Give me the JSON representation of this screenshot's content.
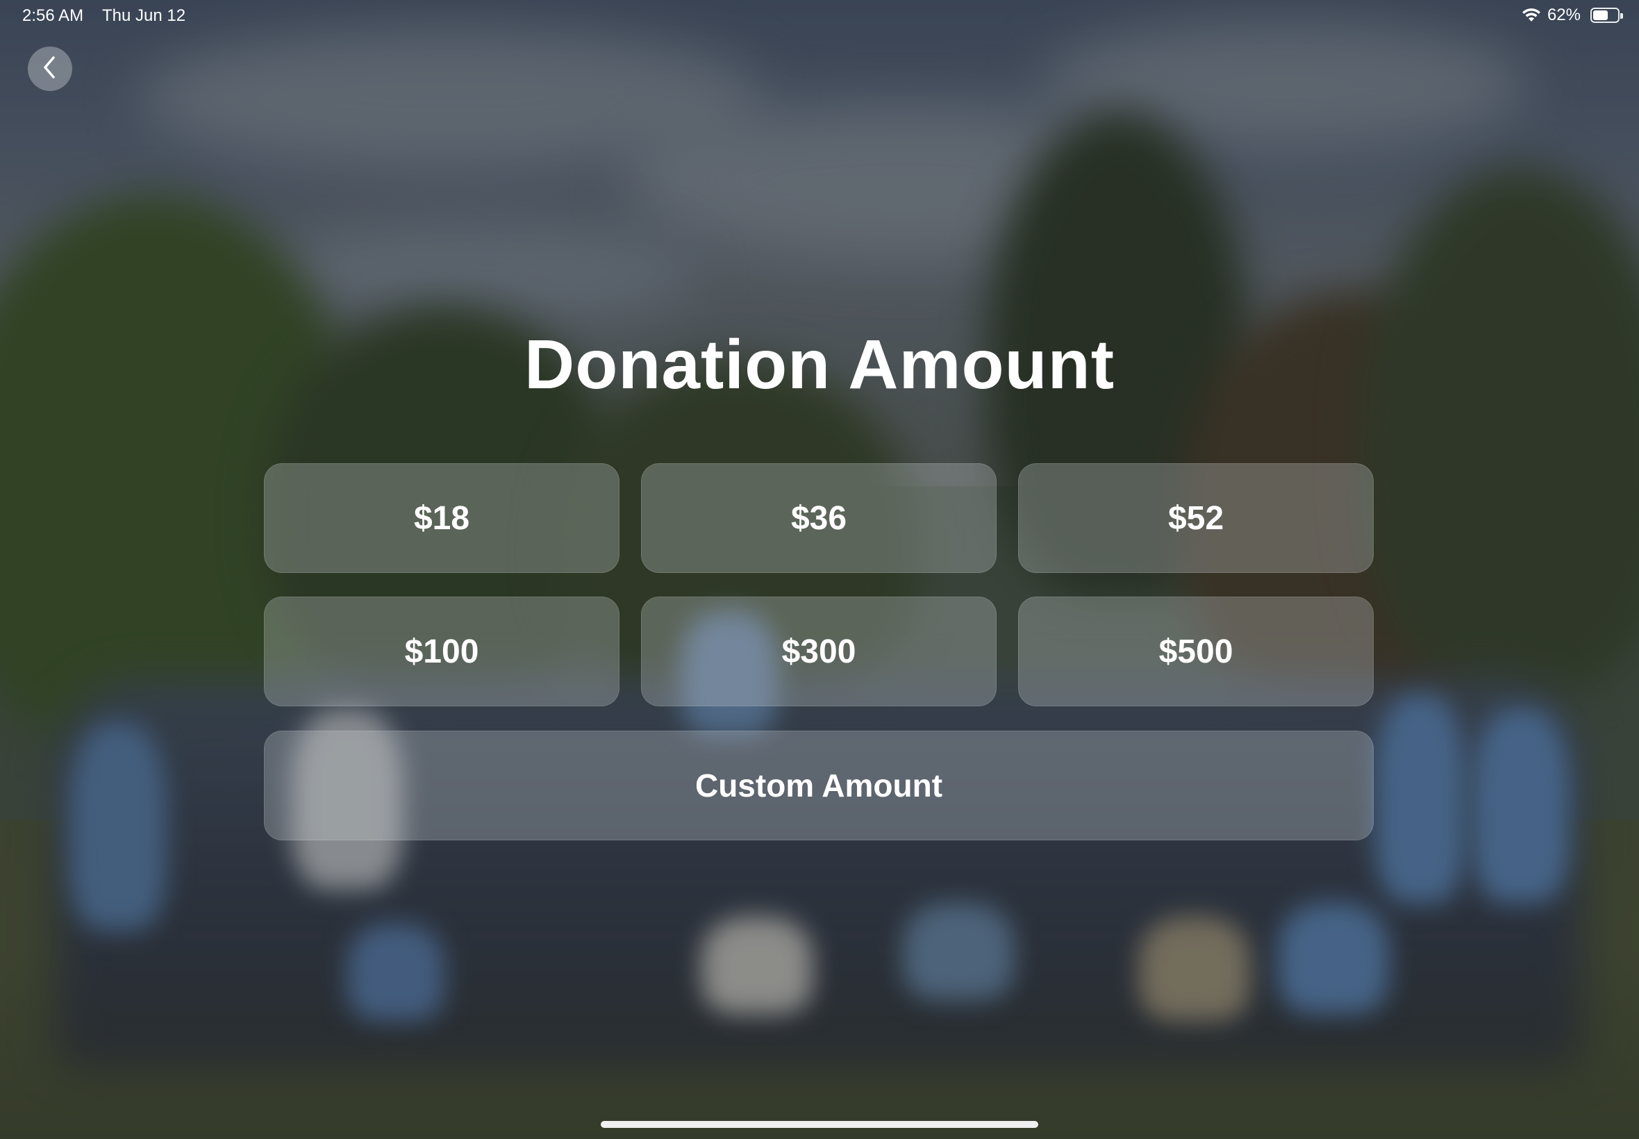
{
  "status_bar": {
    "time": "2:56 AM",
    "date": "Thu Jun 12",
    "battery_percent_label": "62%",
    "battery_level": 0.62
  },
  "navigation": {
    "back_icon": "chevron-left-icon"
  },
  "page": {
    "title": "Donation Amount"
  },
  "amounts": [
    {
      "label": "$18"
    },
    {
      "label": "$36"
    },
    {
      "label": "$52"
    },
    {
      "label": "$100"
    },
    {
      "label": "$300"
    },
    {
      "label": "$500"
    }
  ],
  "custom": {
    "label": "Custom Amount"
  },
  "colors": {
    "text": "#ffffff",
    "button_bg": "rgba(200,205,210,0.30)"
  }
}
